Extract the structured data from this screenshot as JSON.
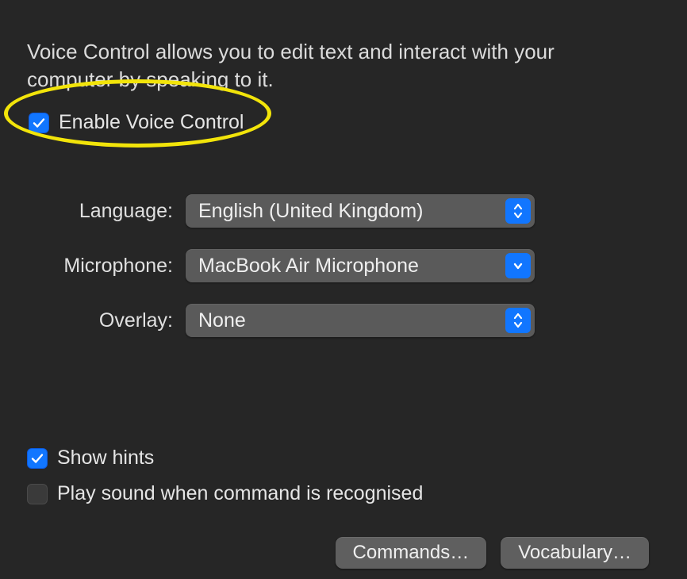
{
  "intro": "Voice Control allows you to edit text and interact with your computer by speaking to it.",
  "enable": {
    "label": "Enable Voice Control",
    "checked": true
  },
  "form": {
    "language": {
      "label": "Language:",
      "value": "English (United Kingdom)"
    },
    "microphone": {
      "label": "Microphone:",
      "value": "MacBook Air Microphone"
    },
    "overlay": {
      "label": "Overlay:",
      "value": "None"
    }
  },
  "options": {
    "show_hints": {
      "label": "Show hints",
      "checked": true
    },
    "play_sound": {
      "label": "Play sound when command is recognised",
      "checked": false
    }
  },
  "buttons": {
    "commands": "Commands…",
    "vocabulary": "Vocabulary…"
  }
}
